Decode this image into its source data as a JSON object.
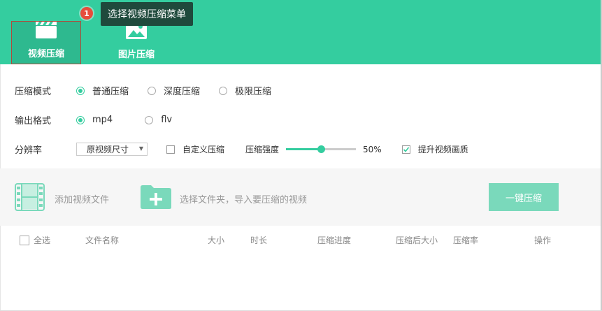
{
  "nav": {
    "tabs": [
      {
        "label": "视频压缩",
        "icon": "clapperboard-icon",
        "active": true
      },
      {
        "label": "图片压缩",
        "icon": "image-icon",
        "active": false
      }
    ]
  },
  "tooltip": {
    "badge": "1",
    "text": "选择视频压缩菜单"
  },
  "settings": {
    "mode": {
      "label": "压缩模式",
      "options": [
        "普通压缩",
        "深度压缩",
        "极限压缩"
      ],
      "selected": "普通压缩"
    },
    "format": {
      "label": "输出格式",
      "options": [
        "mp4",
        "flv"
      ],
      "selected": "mp4"
    },
    "resolution": {
      "label": "分辨率",
      "select_value": "原视频尺寸",
      "custom_label": "自定义压缩",
      "custom_checked": false,
      "strength_label": "压缩强度",
      "strength_value": 50,
      "strength_text": "50%",
      "enhance_label": "提升视频画质",
      "enhance_checked": true
    }
  },
  "actions": {
    "add_file": "添加视频文件",
    "add_folder": "选择文件夹，导入要压缩的视频",
    "compress_button": "一键压缩"
  },
  "table": {
    "select_all": "全选",
    "columns": [
      "文件名称",
      "大小",
      "时长",
      "压缩进度",
      "压缩后大小",
      "压缩率",
      "操作"
    ]
  },
  "colors": {
    "accent": "#34cd9f",
    "button": "#7ad9bb",
    "tooltip_bg": "#1f4a3c",
    "badge": "#e74c3c"
  }
}
